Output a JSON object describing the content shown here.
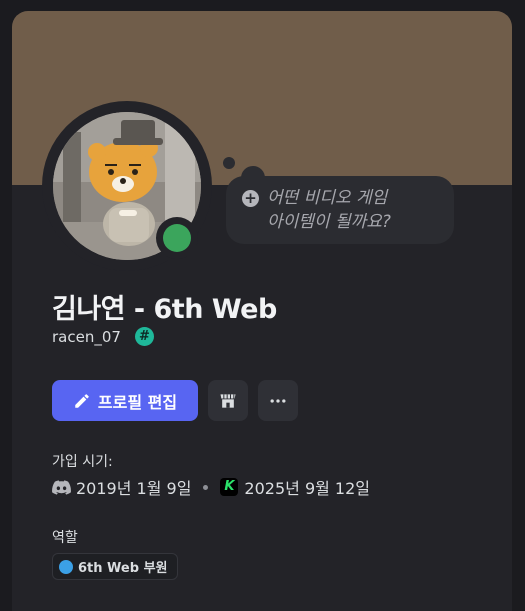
{
  "profile": {
    "display_name": "김나연 - 6th Web",
    "username": "racen_07",
    "tag_badge": "#",
    "status": "online",
    "custom_status_placeholder": "어떤 비디오 게임 아이템이 될까요?",
    "avatar_icon": "ryan-character-avatar"
  },
  "actions": {
    "edit_profile_label": "프로필 편집",
    "shop_icon": "shop-icon",
    "more_icon": "more-icon"
  },
  "joined": {
    "label": "가입 시기:",
    "discord_date": "2019년 1월 9일",
    "server_date": "2025년 9월 12일",
    "server_icon_letter": "K"
  },
  "roles": {
    "label": "역할",
    "items": [
      {
        "name": "6th Web 부원",
        "color": "#3ba0e6"
      }
    ]
  },
  "colors": {
    "banner": "#705d4a",
    "accent": "#5865f2",
    "online": "#3ba55c",
    "tag_badge": "#1fb89a"
  }
}
